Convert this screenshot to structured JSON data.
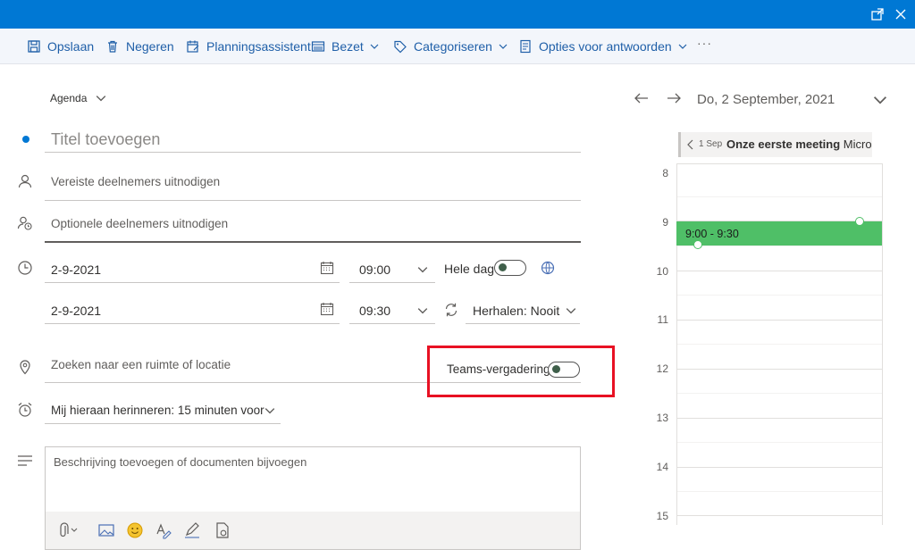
{
  "toolbar": {
    "save": "Opslaan",
    "discard": "Negeren",
    "scheduling": "Planningsassistent",
    "busy": "Bezet",
    "categorize": "Categoriseren",
    "response_options": "Opties voor antwoorden",
    "more": "···"
  },
  "form": {
    "calendar": "Agenda",
    "title_placeholder": "Titel toevoegen",
    "required_placeholder": "Vereiste deelnemers uitnodigen",
    "optional_placeholder": "Optionele deelnemers uitnodigen",
    "start_date": "2-9-2021",
    "start_time": "09:00",
    "all_day": "Hele dag",
    "end_date": "2-9-2021",
    "end_time": "09:30",
    "repeat": "Herhalen: Nooit",
    "location_placeholder": "Zoeken naar een ruimte of locatie",
    "teams": "Teams-vergadering",
    "reminder": "Mij hieraan herinneren: 15 minuten voor",
    "description_placeholder": "Beschrijving toevoegen of documenten bijvoegen"
  },
  "calendar": {
    "date": "Do, 2 September, 2021",
    "other_event_date": "1 Sep",
    "other_event_title": "Onze eerste meeting",
    "other_event_extra": "Micros",
    "hours": [
      "8",
      "9",
      "10",
      "11",
      "12",
      "13",
      "14",
      "15"
    ],
    "event_time": "9:00 - 9:30"
  },
  "colors": {
    "topbar": "#0078d4",
    "accent": "#1f5fa8",
    "event": "#4fbf67",
    "highlight": "#e81123"
  }
}
